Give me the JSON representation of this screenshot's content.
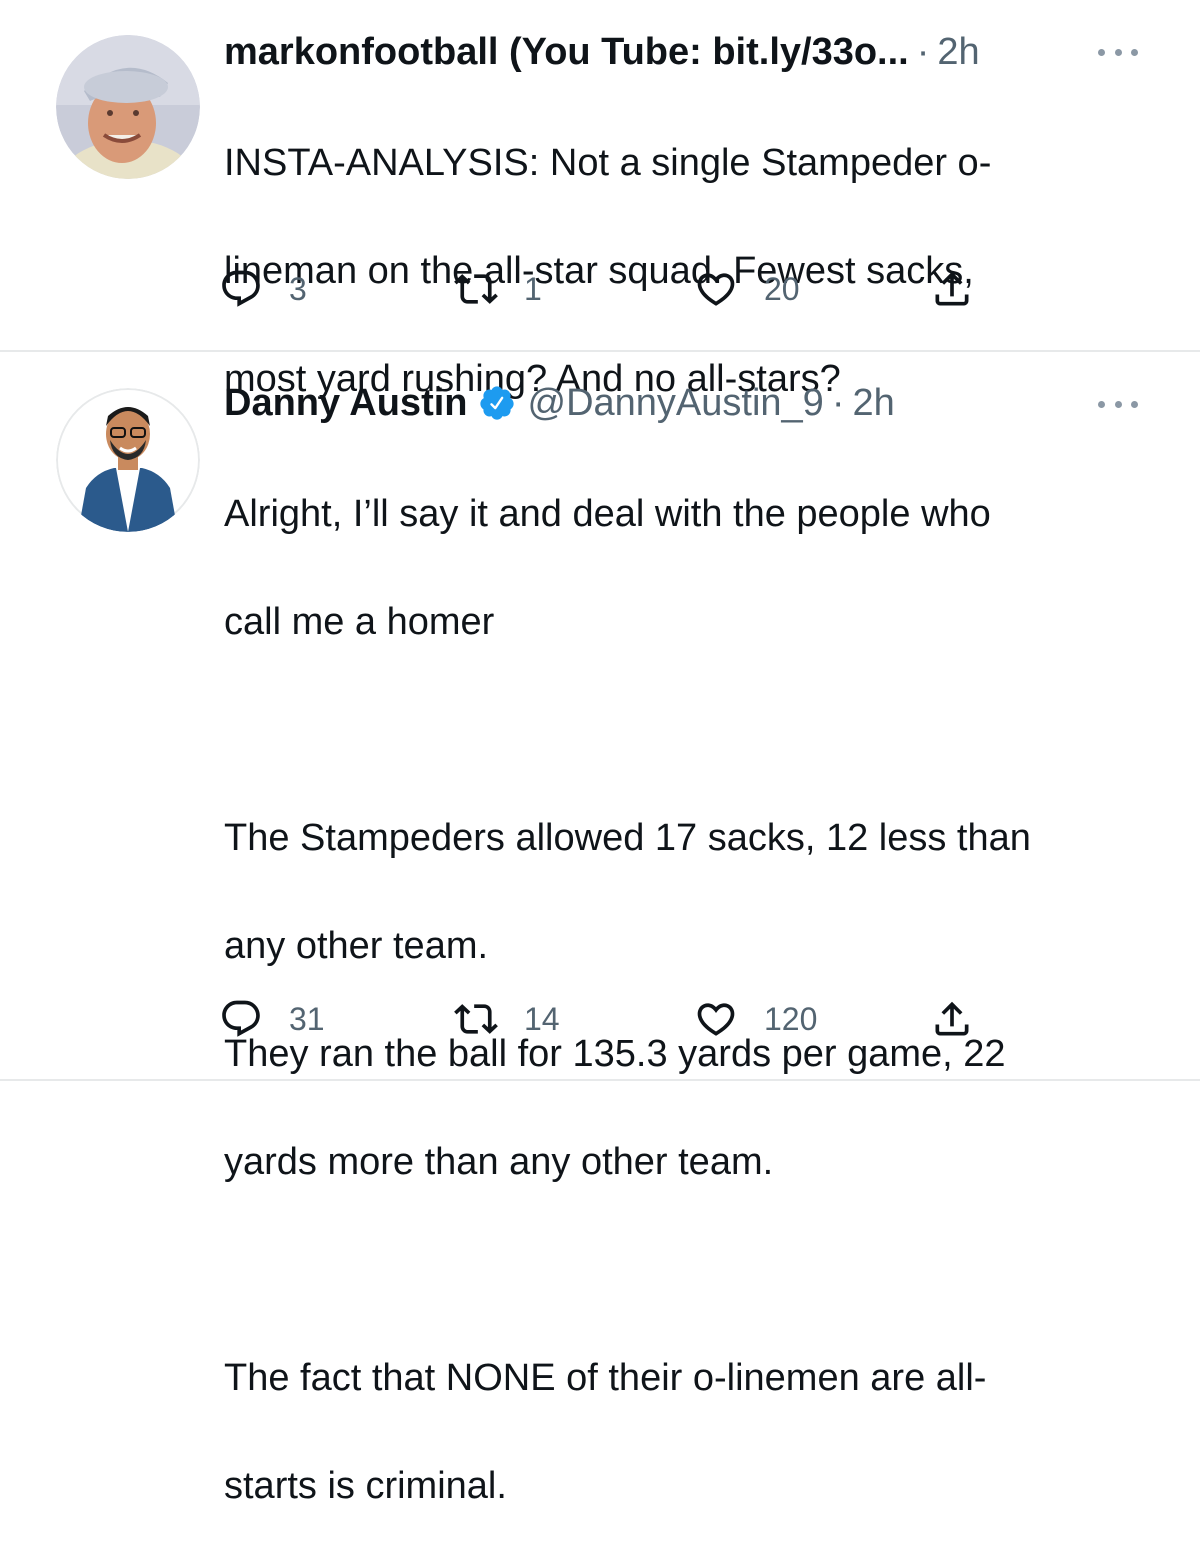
{
  "tweets": [
    {
      "name": "markonfootball (You Tube: bit.ly/33o...",
      "handle": "",
      "time": "2h",
      "text": "INSTA-ANALYSIS:  Not a single Stampeder o-lineman on the all-star squad.  Fewest sacks, most yard rushing?  And no all-stars?",
      "text_lines": [
        "INSTA-ANALYSIS:  Not a single Stampeder o-",
        "lineman on the all-star squad.  Fewest sacks,",
        "most yard rushing?  And no all-stars?"
      ],
      "replies": "3",
      "retweets": "1",
      "likes": "20",
      "verified": false
    },
    {
      "name": "Danny Austin",
      "handle": "@DannyAustin_9",
      "time": "2h",
      "text_lines": [
        "Alright, I’ll say it and deal with the people who",
        "call me a homer",
        "",
        "The Stampeders allowed 17 sacks, 12 less than",
        "any other team.",
        "They ran the ball for 135.3 yards per game, 22",
        "yards more than any other team.",
        "",
        "The fact that NONE of their o-linemen are all-",
        "starts is criminal."
      ],
      "replies": "31",
      "retweets": "14",
      "likes": "120",
      "verified": true
    }
  ],
  "icons": {
    "reply": "reply-icon",
    "retweet": "retweet-icon",
    "like": "heart-icon",
    "share": "share-icon",
    "more": "more-options-icon",
    "verified": "verified-badge-icon"
  },
  "colors": {
    "text": "#0f1419",
    "secondary": "#536471",
    "verified": "#1d9bf0",
    "divider": "#e7e9ea"
  }
}
